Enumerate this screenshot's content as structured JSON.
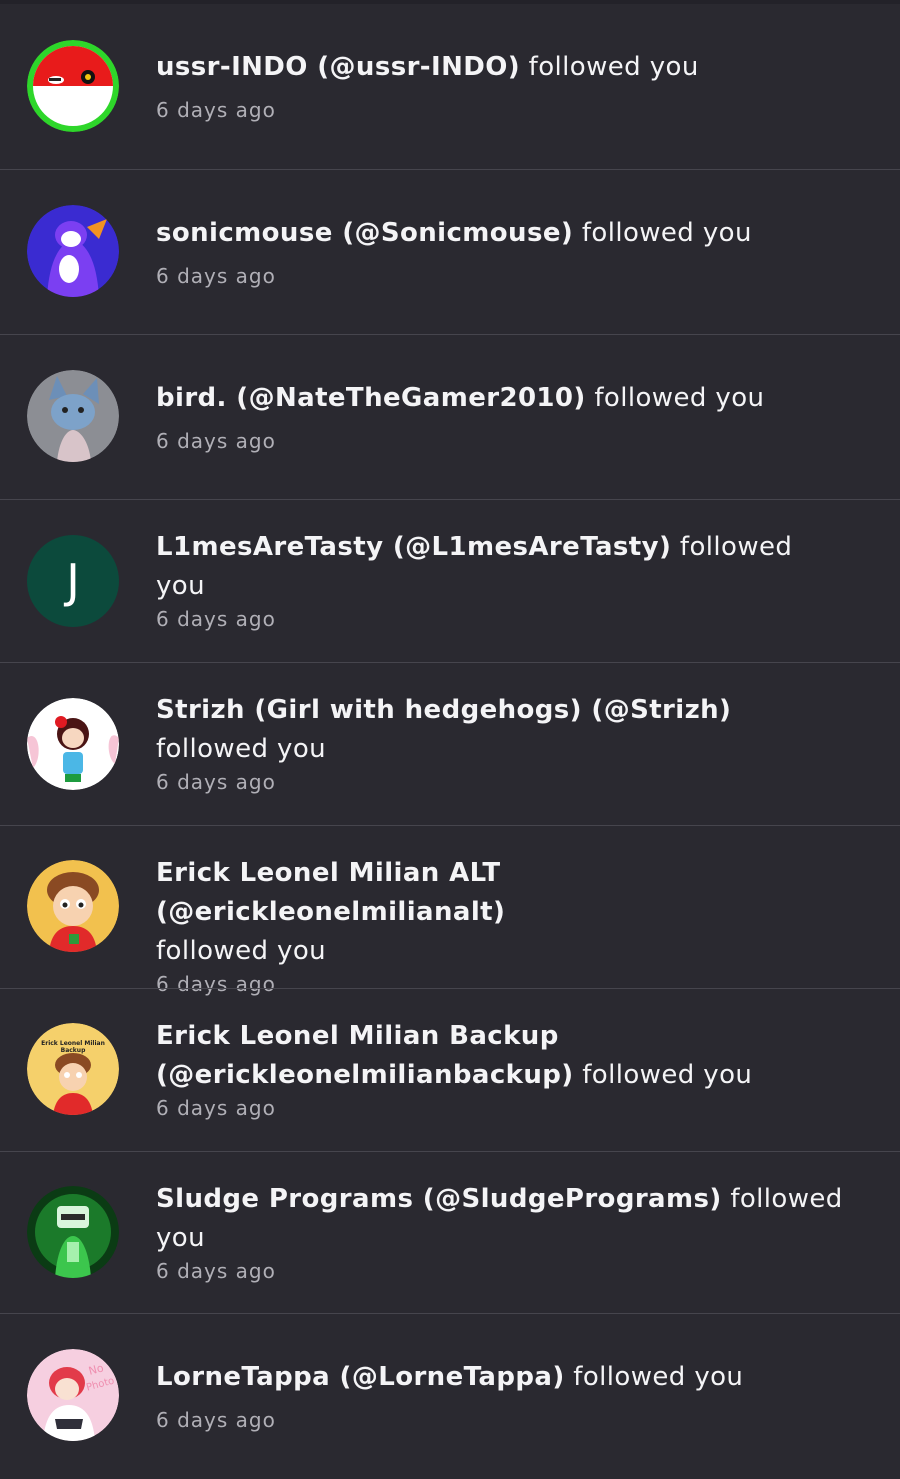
{
  "notifications": [
    {
      "line1_name": "ussr-INDO (@ussr-INDO)",
      "line1_action": " followed you",
      "line2_name": "",
      "line2_action": "",
      "time": "6 days ago",
      "avatar": "flag-ball-icon"
    },
    {
      "line1_name": "sonicmouse (@Sonicmouse)",
      "line1_action": " followed you",
      "line2_name": "",
      "line2_action": "",
      "time": "6 days ago",
      "avatar": "purple-character-icon"
    },
    {
      "line1_name": "bird. (@NateTheGamer2010)",
      "line1_action": " followed you",
      "line2_name": "",
      "line2_action": "",
      "time": "6 days ago",
      "avatar": "blue-wolf-character-icon"
    },
    {
      "line1_name": "L1mesAreTasty (@L1mesAreTasty)",
      "line1_action": " followed",
      "line2_name": "",
      "line2_action": "you",
      "time": "6 days ago",
      "avatar": "letter-avatar",
      "letter": "J"
    },
    {
      "line1_name": "Strizh (Girl with hedgehogs) (@Strizh)",
      "line1_action": "",
      "line2_name": "",
      "line2_action": "followed you",
      "time": "6 days ago",
      "avatar": "girl-character-icon"
    },
    {
      "line1_name": "Erick Leonel Milian ALT (@erickleonelmilianalt)",
      "line1_action": "",
      "line2_name": "",
      "line2_action": "followed you",
      "time": "6 days ago",
      "avatar": "boy-cartoon-icon"
    },
    {
      "line1_name": "Erick Leonel Milian Backup",
      "line1_action": "",
      "line2_name": "(@erickleonelmilianbackup)",
      "line2_action": " followed you",
      "time": "6 days ago",
      "avatar": "boy-cartoon-backup-icon",
      "avatar_caption": "Erick Leonel Milian Backup"
    },
    {
      "line1_name": "Sludge Programs (@SludgePrograms)",
      "line1_action": " followed",
      "line2_name": "",
      "line2_action": "you",
      "time": "6 days ago",
      "avatar": "green-robot-icon"
    },
    {
      "line1_name": "LorneTappa (@LorneTappa)",
      "line1_action": " followed you",
      "line2_name": "",
      "line2_action": "",
      "time": "6 days ago",
      "avatar": "anime-character-icon",
      "avatar_caption": "No Photo"
    }
  ],
  "colors": {
    "background": "#2a2930",
    "divider": "#46454d",
    "text": "#f4f4f6",
    "muted": "#b0afb6",
    "letter_avatar_bg": "#0c4a3c"
  }
}
